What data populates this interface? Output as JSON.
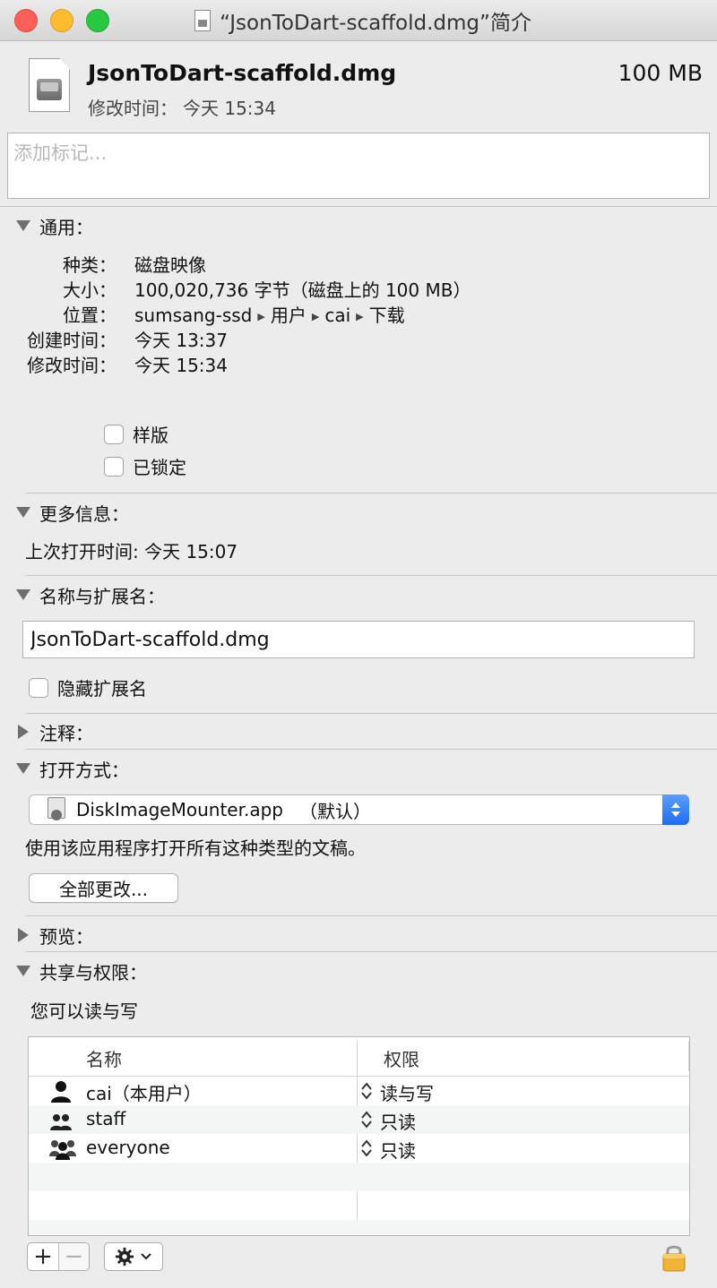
{
  "window": {
    "title": "“JsonToDart-scaffold.dmg”简介"
  },
  "header": {
    "file_name": "JsonToDart-scaffold.dmg",
    "size": "100 MB",
    "modified_label": "修改时间",
    "modified_value": "今天 15:34"
  },
  "tags": {
    "placeholder": "添加标记..."
  },
  "general": {
    "title": "通用",
    "kind_label": "种类",
    "kind_value": "磁盘映像",
    "size_label": "大小",
    "size_value": "100,020,736 字节（磁盘上的 100 MB）",
    "where_label": "位置",
    "path": [
      "sumsang-ssd",
      "用户",
      "cai",
      "下载"
    ],
    "created_label": "创建时间",
    "created_value": "今天 13:37",
    "modified_label": "修改时间",
    "modified_value": "今天 15:34",
    "stationery_label": "样版",
    "locked_label": "已锁定"
  },
  "more_info": {
    "title": "更多信息",
    "last_opened": "上次打开时间: 今天 15:07"
  },
  "name_ext": {
    "title": "名称与扩展名",
    "value": "JsonToDart-scaffold.dmg",
    "hide_ext_label": "隐藏扩展名"
  },
  "comments": {
    "title": "注释"
  },
  "open_with": {
    "title": "打开方式",
    "app": "DiskImageMounter.app",
    "default_suffix": "（默认）",
    "description": "使用该应用程序打开所有这种类型的文稿。",
    "change_all_label": "全部更改..."
  },
  "preview": {
    "title": "预览"
  },
  "sharing": {
    "title": "共享与权限",
    "summary": "您可以读与写",
    "col_name": "名称",
    "col_privilege": "权限",
    "rows": [
      {
        "name": "cai（本用户）",
        "privilege": "读与写",
        "icon": "single-user-icon"
      },
      {
        "name": "staff",
        "privilege": "只读",
        "icon": "group-icon"
      },
      {
        "name": "everyone",
        "privilege": "只读",
        "icon": "everyone-icon"
      }
    ]
  },
  "bottom": {
    "add_label": "+",
    "remove_label": "−"
  },
  "colors": {
    "close": "#fc5f57",
    "minimize": "#fdbc2e",
    "zoom": "#28c840",
    "accent": "#1e6cf0"
  }
}
